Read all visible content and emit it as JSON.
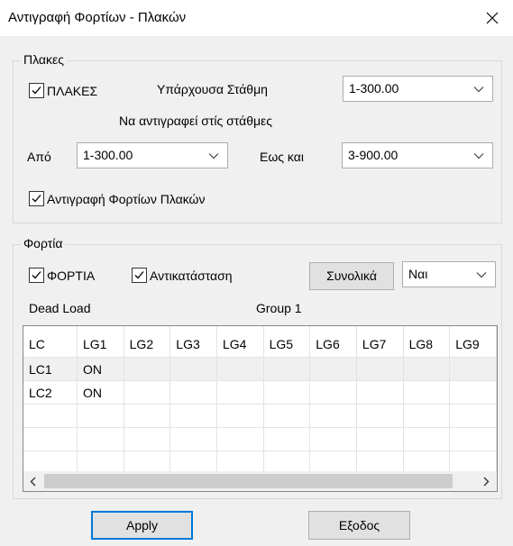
{
  "window": {
    "title": "Αντιγραφή Φορτίων - Πλακών"
  },
  "plakes": {
    "legend": "Πλακες",
    "plakes_checkbox": "ΠΛΑΚΕΣ",
    "existing_level_label": "Υπάρχουσα Στάθμη",
    "existing_level_value": "1-300.00",
    "copy_to_label": "Να αντιγραφεί στίς στάθμες",
    "from_label": "Από",
    "from_value": "1-300.00",
    "to_label": "Εως και",
    "to_value": "3-900.00",
    "copy_loads_checkbox": "Αντιγραφή Φορτίων Πλακών"
  },
  "fortia": {
    "legend": "Φορτία",
    "fortia_checkbox": "ΦΟΡΤΙΑ",
    "replace_checkbox": "Αντικατάσταση",
    "totals_button": "Συνολικά",
    "yes_value": "Ναι",
    "dead_load_label": "Dead Load",
    "group_label": "Group 1"
  },
  "grid": {
    "headers": [
      "LC",
      "LG1",
      "LG2",
      "LG3",
      "LG4",
      "LG5",
      "LG6",
      "LG7",
      "LG8",
      "LG9"
    ],
    "rows": [
      [
        "LC1",
        "ON",
        "",
        "",
        "",
        "",
        "",
        "",
        "",
        ""
      ],
      [
        "LC2",
        "ON",
        "",
        "",
        "",
        "",
        "",
        "",
        "",
        ""
      ]
    ]
  },
  "buttons": {
    "apply": "Apply",
    "exit": "Εξοδος"
  },
  "icons": {
    "close": "close-icon",
    "dropdown": "chevron-down-icon",
    "check": "check-icon",
    "scroll_left": "scroll-left-icon",
    "scroll_right": "scroll-right-icon"
  }
}
